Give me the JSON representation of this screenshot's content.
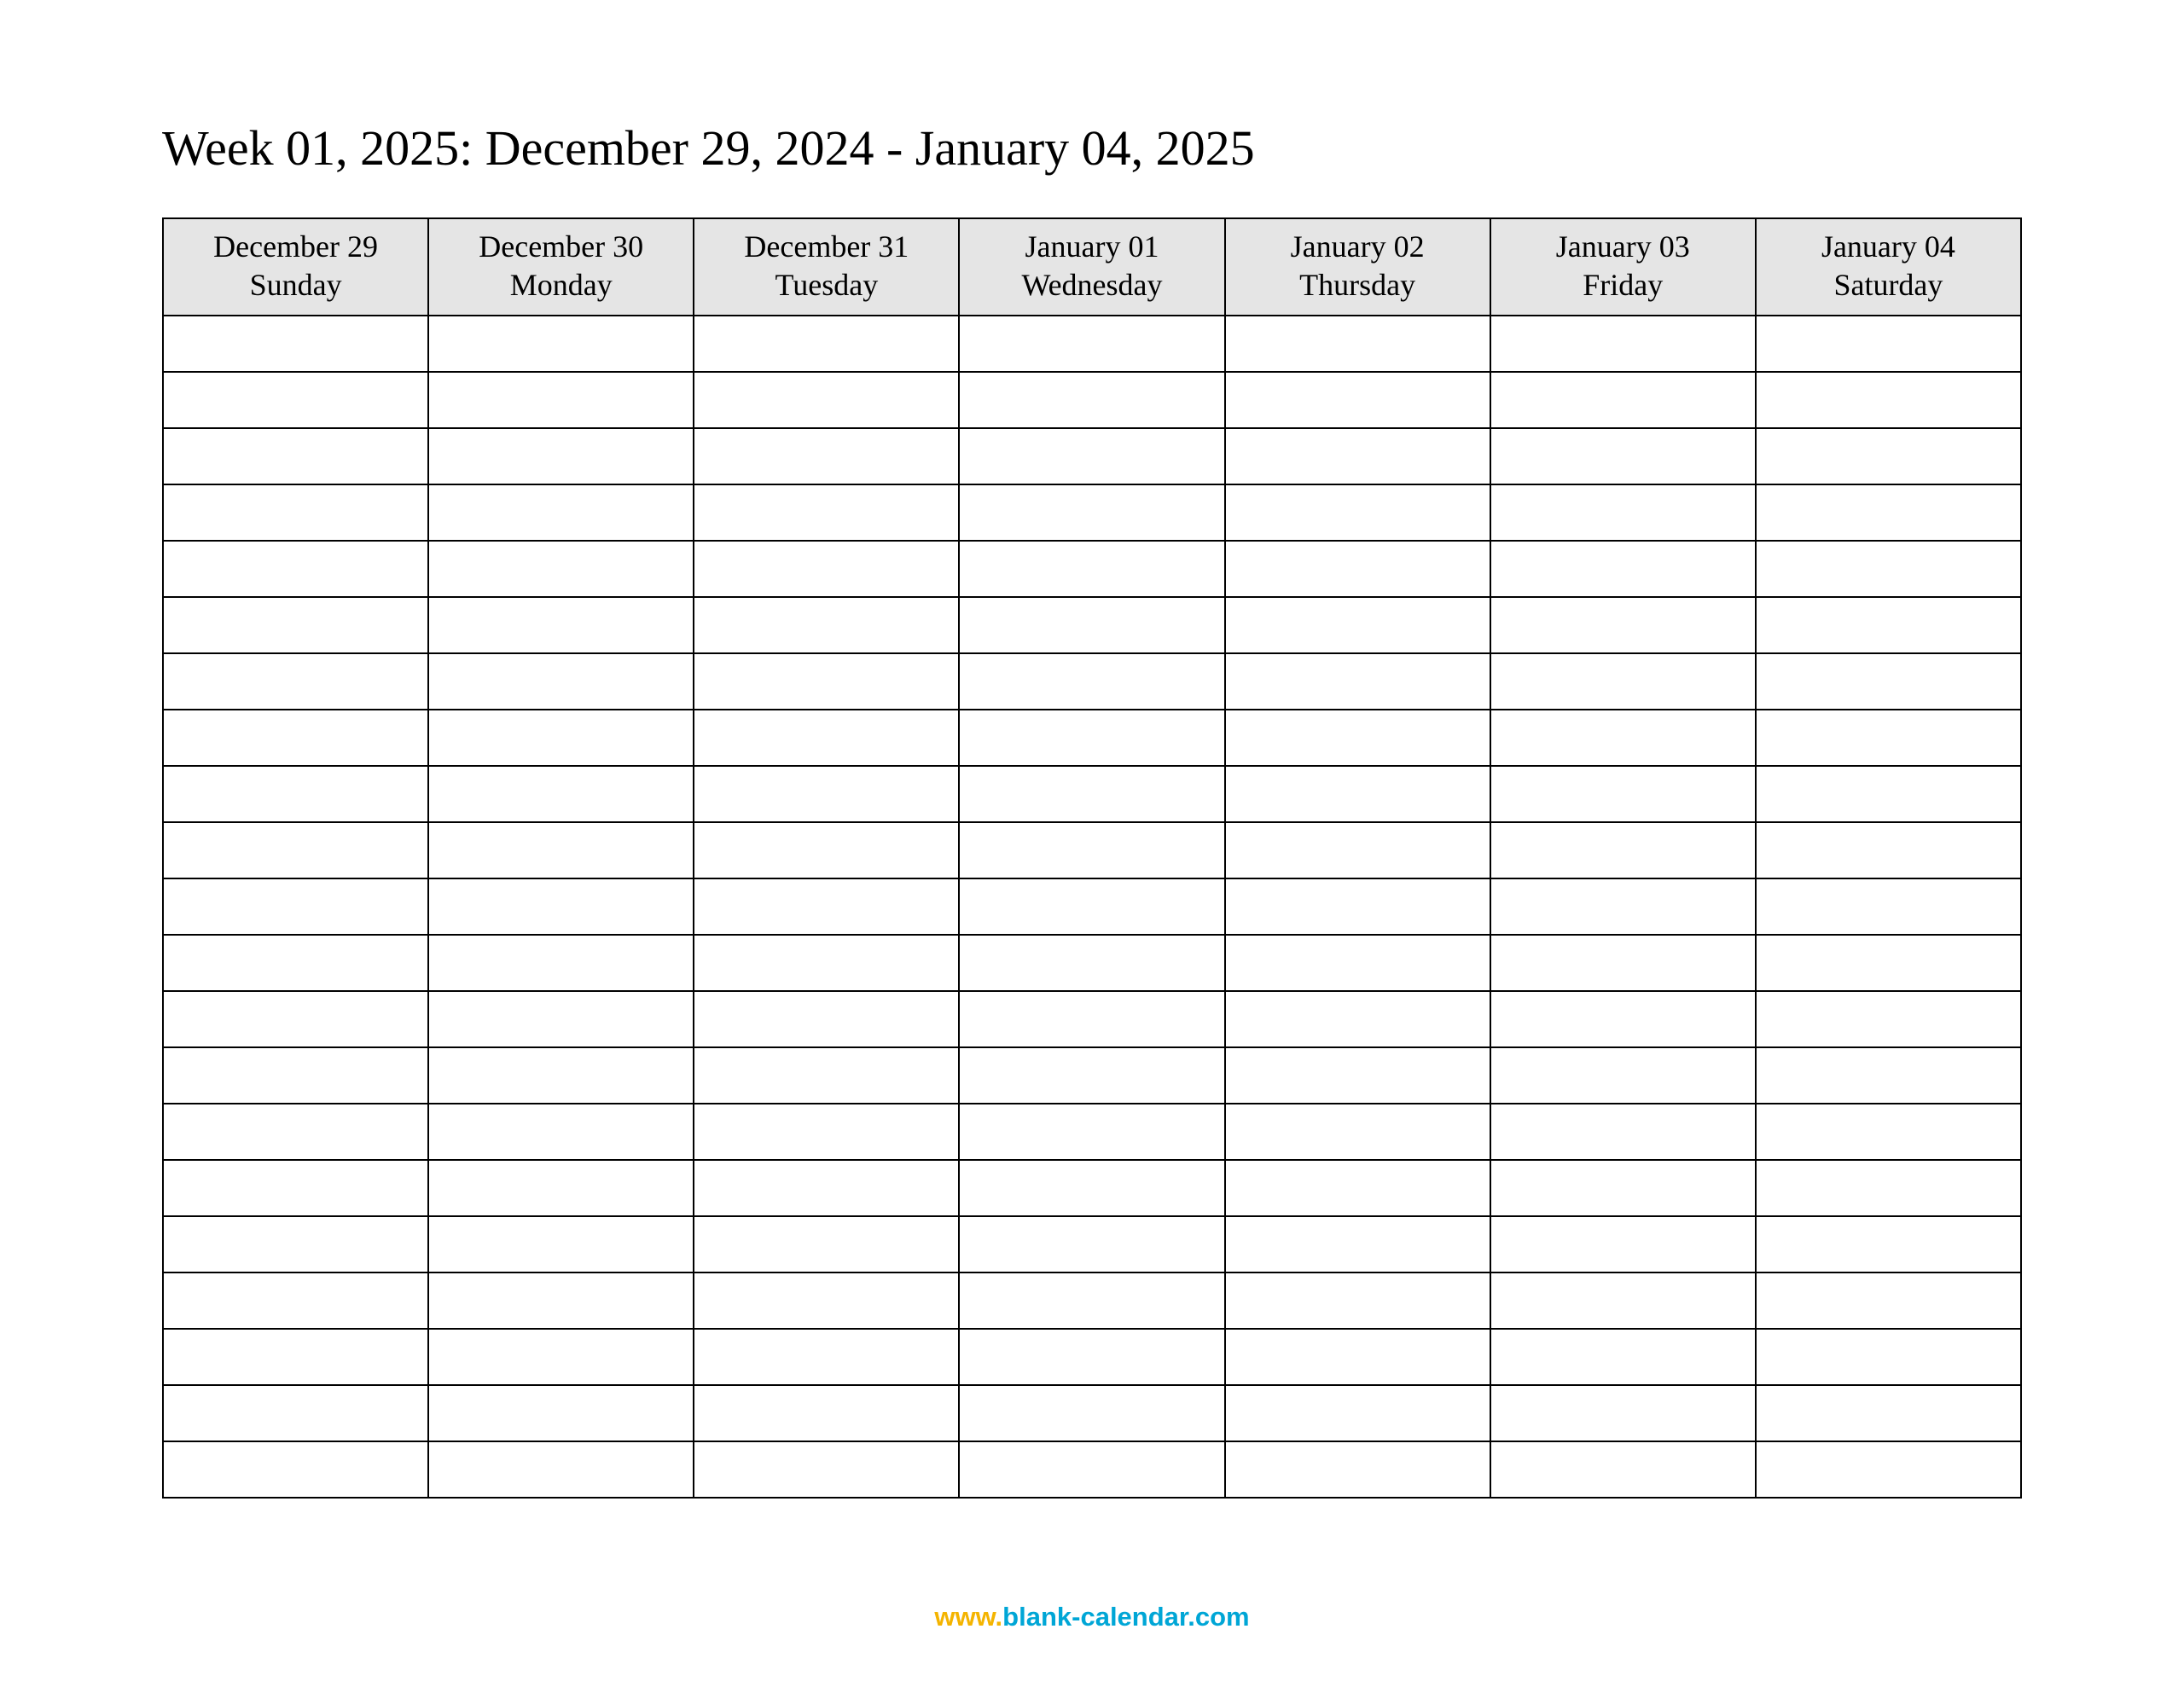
{
  "title": "Week 01, 2025: December 29, 2024 - January 04, 2025",
  "days": [
    {
      "date": "December 29",
      "weekday": "Sunday"
    },
    {
      "date": "December 30",
      "weekday": "Monday"
    },
    {
      "date": "December 31",
      "weekday": "Tuesday"
    },
    {
      "date": "January 01",
      "weekday": "Wednesday"
    },
    {
      "date": "January 02",
      "weekday": "Thursday"
    },
    {
      "date": "January 03",
      "weekday": "Friday"
    },
    {
      "date": "January 04",
      "weekday": "Saturday"
    }
  ],
  "row_count": 21,
  "footer": {
    "www": "www.",
    "domain": "blank-calendar.com"
  }
}
